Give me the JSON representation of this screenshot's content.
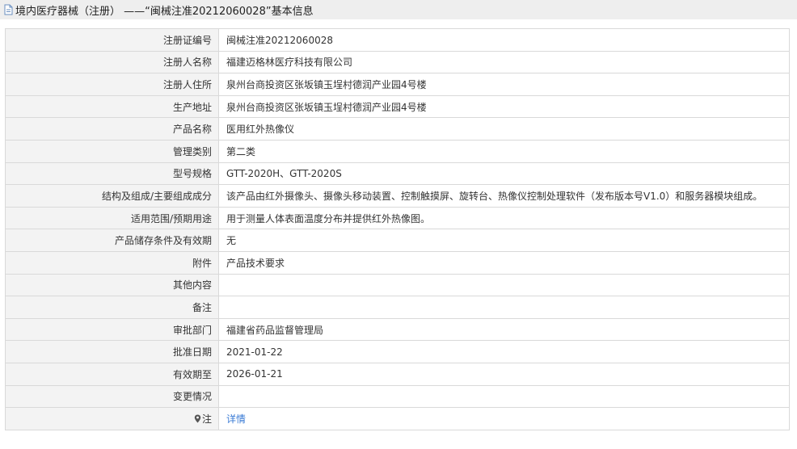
{
  "header": {
    "title": "境内医疗器械（注册） ——“闽械注准20212060028”基本信息",
    "icon": "document-icon"
  },
  "rows": [
    {
      "label": "注册证编号",
      "value": "闽械注准20212060028"
    },
    {
      "label": "注册人名称",
      "value": "福建迈格林医疗科技有限公司"
    },
    {
      "label": "注册人住所",
      "value": "泉州台商投资区张坂镇玉埕村德润产业园4号楼"
    },
    {
      "label": "生产地址",
      "value": "泉州台商投资区张坂镇玉埕村德润产业园4号楼"
    },
    {
      "label": "产品名称",
      "value": "医用红外热像仪"
    },
    {
      "label": "管理类别",
      "value": "第二类"
    },
    {
      "label": "型号规格",
      "value": "GTT-2020H、GTT-2020S"
    },
    {
      "label": "结构及组成/主要组成成分",
      "value": "该产品由红外摄像头、摄像头移动装置、控制触摸屏、旋转台、热像仪控制处理软件（发布版本号V1.0）和服务器模块组成。"
    },
    {
      "label": "适用范围/预期用途",
      "value": "用于测量人体表面温度分布并提供红外热像图。"
    },
    {
      "label": "产品储存条件及有效期",
      "value": "无"
    },
    {
      "label": "附件",
      "value": "产品技术要求"
    },
    {
      "label": "其他内容",
      "value": ""
    },
    {
      "label": "备注",
      "value": ""
    },
    {
      "label": "审批部门",
      "value": "福建省药品监督管理局"
    },
    {
      "label": "批准日期",
      "value": "2021-01-22"
    },
    {
      "label": "有效期至",
      "value": "2026-01-21"
    },
    {
      "label": "变更情况",
      "value": ""
    }
  ],
  "note_row": {
    "label": "注",
    "icon": "location-pin-icon",
    "link_text": "详情"
  },
  "colors": {
    "header_bg": "#eeeeee",
    "label_bg": "#f3f3f3",
    "border": "#d9d9d9",
    "link": "#3a7bd5"
  }
}
